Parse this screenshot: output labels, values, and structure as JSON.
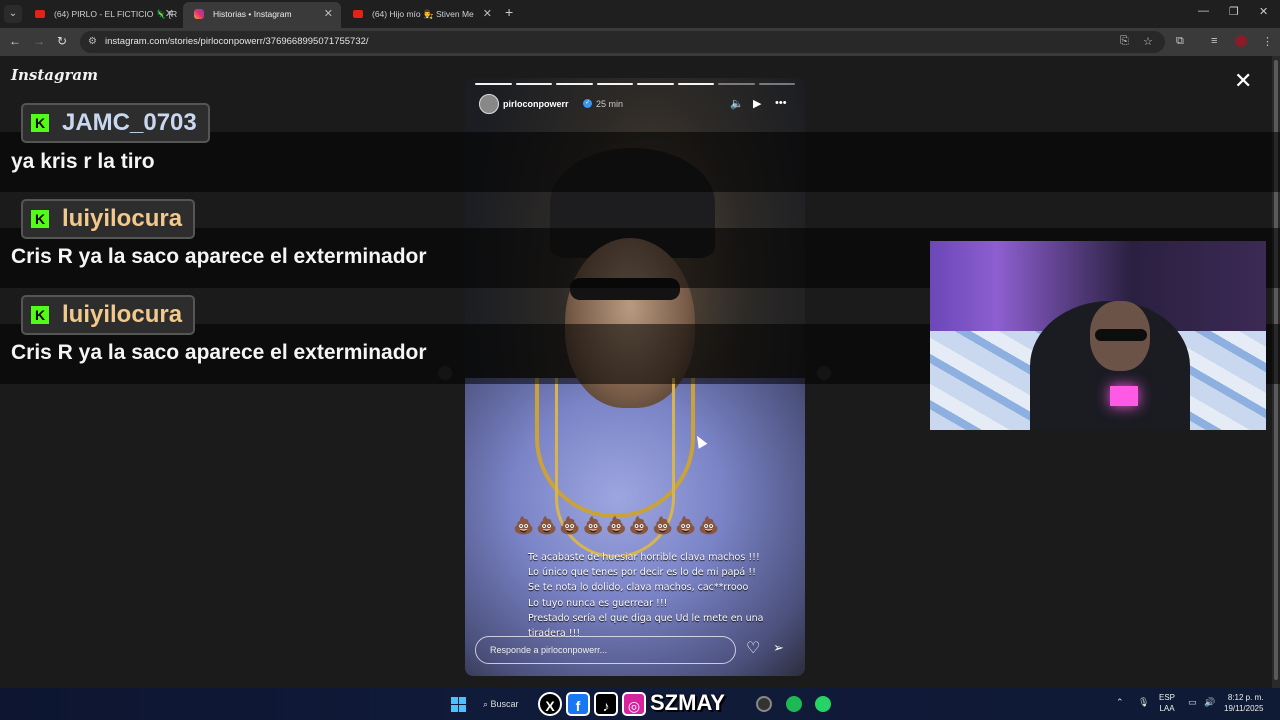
{
  "browser": {
    "tabs": [
      {
        "label": "(64) PIRLO - EL FICTICIO 🦎 [R",
        "active": false
      },
      {
        "label": "Historias • Instagram",
        "active": true
      },
      {
        "label": "(64) Hijo mío 👨‍⚖️ Stiven Me",
        "active": false
      }
    ],
    "new_tab": "+",
    "url": "instagram.com/stories/pirloconpowerr/3769668995071755732/"
  },
  "instagram": {
    "logo": "Instagram",
    "close": "✕"
  },
  "story": {
    "username": "pirloconpowerr",
    "time": "25 min",
    "emojis": "💩💩💩💩💩💩💩💩💩",
    "caption_lines": [
      "Te acabaste de huesiar horrible clava machos !!!",
      "Lo único que tenes por decir es lo de mi papá !!",
      "Se te nota lo dolido, clava machos, cac**rrooo",
      "Lo tuyo nunca es guerrear !!!",
      "Prestado sería el que diga que Ud le mete en una",
      "tiradera !!!"
    ],
    "reply_placeholder": "Responde a pirloconpowerr..."
  },
  "chat": [
    {
      "user": "JAMC_0703",
      "user_color": "#c8d8f0",
      "message": "ya kris r la tiro"
    },
    {
      "user": "luiyilocura",
      "user_color": "#f2c98a",
      "message": "Cris R ya la saco aparece el exterminador"
    },
    {
      "user": "luiyilocura",
      "user_color": "#f2c98a",
      "message": "Cris R ya la saco aparece el exterminador"
    }
  ],
  "chat_badge": "K",
  "taskbar": {
    "search_label": "Buscar",
    "overlay_name": "SZMAY",
    "lang_1": "ESP",
    "lang_2": "LAA",
    "time": "8:12 p. m.",
    "date": "19/11/2025"
  }
}
